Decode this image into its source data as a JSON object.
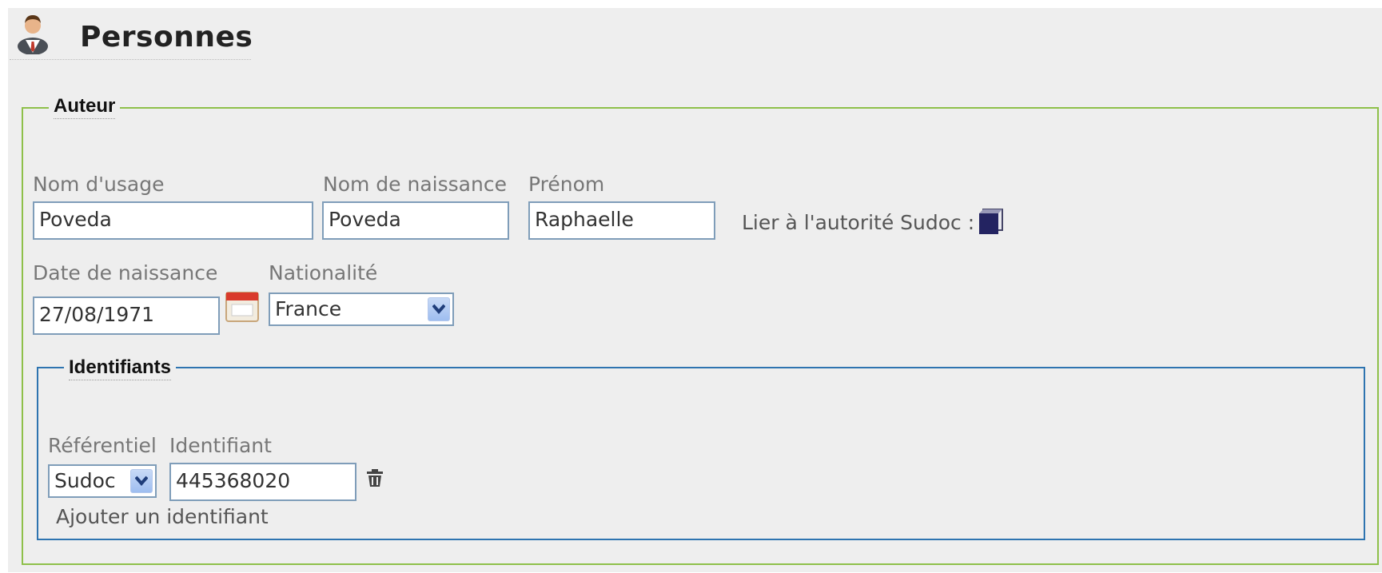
{
  "section": {
    "title": "Personnes",
    "icon": "person-icon"
  },
  "auteur": {
    "legend": "Auteur",
    "nom_usage": {
      "label": "Nom d'usage",
      "value": "Poveda"
    },
    "nom_naissance": {
      "label": "Nom de naissance",
      "value": "Poveda"
    },
    "prenom": {
      "label": "Prénom",
      "value": "Raphaelle"
    },
    "sudoc_link": {
      "label": "Lier à l'autorité Sudoc :",
      "icon": "cube-icon"
    },
    "date_naissance": {
      "label": "Date de naissance",
      "value": "27/08/1971",
      "icon": "calendar-icon"
    },
    "nationalite": {
      "label": "Nationalité",
      "selected": "France"
    }
  },
  "identifiants": {
    "legend": "Identifiants",
    "referentiel": {
      "label": "Référentiel",
      "selected": "Sudoc"
    },
    "identifiant": {
      "label": "Identifiant",
      "value": "445368020"
    },
    "delete_icon": "trash-icon",
    "add_label": "Ajouter un identifiant"
  },
  "colors": {
    "auteur_border": "#8ec04a",
    "identifiants_border": "#2e74b0",
    "input_border": "#7f9db9",
    "panel_bg": "#eeeeee"
  }
}
